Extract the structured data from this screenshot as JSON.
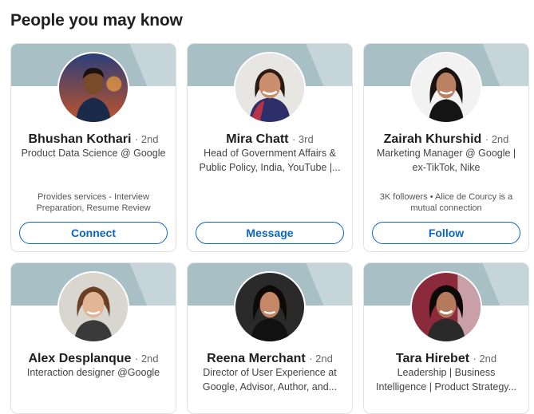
{
  "section": {
    "title": "People you may know"
  },
  "people": [
    {
      "name": "Bhushan Kothari",
      "degree": "· 2nd",
      "headline": [
        "Product Data Science @ Google"
      ],
      "insight": [
        "Provides services - Interview",
        "Preparation, Resume Review"
      ],
      "action": "Connect"
    },
    {
      "name": "Mira Chatt",
      "degree": "· 3rd",
      "headline": [
        "Head of Government Affairs &",
        "Public Policy, India, YouTube |..."
      ],
      "insight": [],
      "action": "Message"
    },
    {
      "name": "Zairah Khurshid",
      "degree": "· 2nd",
      "headline": [
        "Marketing Manager @ Google |",
        "ex-TikTok, Nike"
      ],
      "insight": [
        "3K followers • Alice de Courcy is a",
        "mutual connection"
      ],
      "action": "Follow"
    },
    {
      "name": "Alex Desplanque",
      "degree": "· 2nd",
      "headline": [
        "Interaction designer @Google"
      ],
      "insight": [],
      "action": ""
    },
    {
      "name": "Reena Merchant",
      "degree": "· 2nd",
      "headline": [
        "Director of User Experience at",
        "Google, Advisor, Author, and..."
      ],
      "insight": [],
      "action": ""
    },
    {
      "name": "Tara Hirebet",
      "degree": "· 2nd",
      "headline": [
        "Leadership | Business",
        "Intelligence | Product Strategy..."
      ],
      "insight": [],
      "action": ""
    }
  ]
}
